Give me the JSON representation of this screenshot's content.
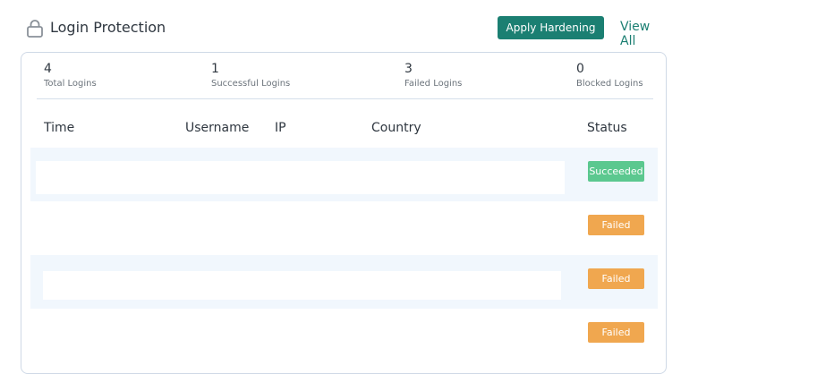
{
  "header": {
    "title": "Login Protection",
    "apply_label": "Apply Hardening",
    "view_all_label": "View All",
    "icon": "lock-icon"
  },
  "stats": [
    {
      "value": "4",
      "label": "Total Logins"
    },
    {
      "value": "1",
      "label": "Successful Logins"
    },
    {
      "value": "3",
      "label": "Failed Logins"
    },
    {
      "value": "0",
      "label": "Blocked Logins"
    }
  ],
  "table": {
    "columns": [
      "Time",
      "Username",
      "IP",
      "Country",
      "Status"
    ],
    "rows": [
      {
        "status": "Succeeded"
      },
      {
        "status": "Failed"
      },
      {
        "status": "Failed"
      },
      {
        "status": "Failed"
      }
    ]
  },
  "colors": {
    "accent": "#1b7f72",
    "succeeded": "#5bc88f",
    "failed": "#f0a74f",
    "row_shade": "#f1f7fd"
  }
}
